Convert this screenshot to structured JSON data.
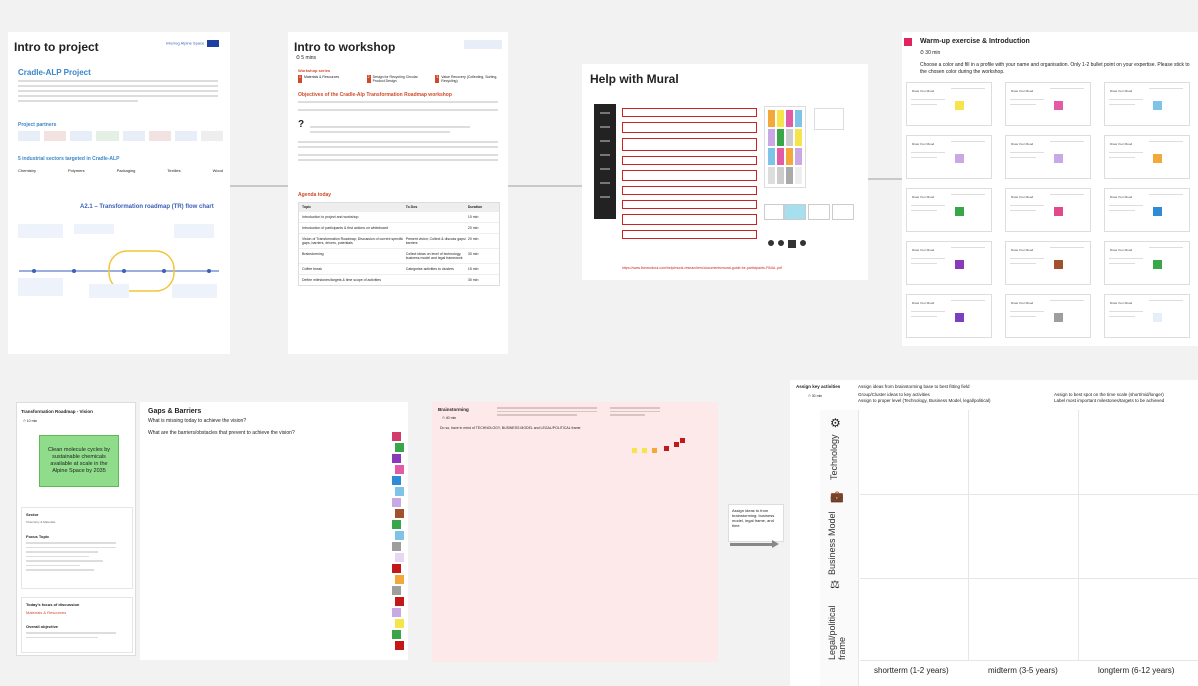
{
  "intro_project": {
    "title": "Intro to project",
    "brand": "Interreg Alpine Space",
    "project_title": "Cradle-ALP Project",
    "partners_label": "Project partners",
    "sectors_label": "5 industrial sectors targeted in Cradle-ALP",
    "sectors": [
      "Chemistry",
      "Polymers",
      "Packaging",
      "Textiles",
      "Wood"
    ],
    "flow_title": "A2.1 – Transformation roadmap (TR) flow chart",
    "colors": {
      "accent": "#3a5fb8",
      "project_title": "#3a86c8"
    }
  },
  "intro_workshop": {
    "title": "Intro to workshop",
    "duration": "5 mins",
    "series_label": "Workshop series",
    "series": [
      "Materials & Resources",
      "Design for Recycling Circular Product Design",
      "Value Recovery (Collecting, Sorting, Recycling)"
    ],
    "objectives_title": "Objectives of the Cradle-Alp Transformation Roadmap workshop",
    "agenda_title": "Agenda today",
    "agenda_headers": [
      "Topic",
      "To Dos",
      "Duration"
    ],
    "agenda_rows": [
      [
        "Introduction to project and workshop",
        "",
        "10 min"
      ],
      [
        "Introduction of participants & first actions on whiteboard",
        "",
        "20 min"
      ],
      [
        "Vision of Transformation Roadmap; Discussion of current specific gaps, barriers, drivers, potentials",
        "Present vision; Collect & discuss gaps/ barriers",
        "20 min"
      ],
      [
        "Brainstorming",
        "Collect ideas on level of technology, business model and legal framework",
        "30 min"
      ],
      [
        "Coffee break",
        "Categorise activities to clusters",
        "15 min"
      ],
      [
        "Define milestones/targets & time scope of activities",
        "",
        "30 min"
      ]
    ]
  },
  "help_mural": {
    "title": "Help with Mural",
    "url": "https://www.liveworkout.com/help/mural-researchers/documents/mural-guide-for-participants-FINAL.pdf"
  },
  "warmup": {
    "title": "Warm-up exercise & Introduction",
    "duration": "30 min",
    "instructions": "Choose a color and fill in a profile with your name and organisation. Only 1-2 bullet point on your expertise. Please stick to the chosen color during the workshop.",
    "card_label": "Draw Your Mood",
    "card_colors": [
      "#f5e44a",
      "#e35aa6",
      "#7ec3e8",
      "#c9a8e6",
      "#c9a8e6",
      "#f2a93a",
      "#3aa64a",
      "#e04a8a",
      "#2f8ad8",
      "#8a3ab8",
      "#a0522d",
      "#3aa64a",
      "#7a40c0",
      "#9e9e9e",
      "#e6eef8",
      "#c21818"
    ]
  },
  "vision": {
    "header": "Transformation Roadmap - Vision",
    "timer": "10 min",
    "vision_text": "Clean molecule cycles by sustainable chemicals available at scale in the Alpine Space by 2035",
    "sector_label": "Sector",
    "sector_value": "Chemistry & Materials",
    "focus_label": "Focus Topic",
    "today_label": "Today's focus of discussion",
    "today_value": "Materials & Resources",
    "objective_label": "Overall objective"
  },
  "gaps": {
    "title": "Gaps & Barriers",
    "subtitle": "What is missing today to achieve the vision?",
    "question": "What are the barriers/obstacles that prevent to achieve the vision?",
    "colors": [
      "#d13a6a",
      "#3aa64a",
      "#8a3ab8",
      "#e35aa6",
      "#2f8ad8",
      "#7ec3e8",
      "#c9a8e6",
      "#a0522d",
      "#3aa64a",
      "#7ec3e8",
      "#9e9e9e",
      "#e6d8f0",
      "#c21818",
      "#f2a93a",
      "#9e9e9e",
      "#c21818",
      "#c9a8e6",
      "#f5e44a",
      "#3aa64a",
      "#c21818"
    ]
  },
  "brainstorm": {
    "title": "Brainstorming",
    "duration": "40 min",
    "focus_line": "Do so, have in mind of TECHNOLOGY, BUSINESS MODEL and LEGAL/POLITICAL frame",
    "next_steps": "Assign ideas to from brainstorming: business model, legal frame, and time",
    "arrow_label": "Assign ideas to from brainstorming: business model, legal frame, and time",
    "sticky_colors": [
      "#c21818",
      "#f5e44a",
      "#f5e44a",
      "#f2a93a",
      "#c21818",
      "#c21818"
    ]
  },
  "roadmap": {
    "assign_title": "Assign key activities",
    "assign_note": "Assign ideas from brainstorming base to best fitting field",
    "bullets": [
      "Group/Cluster ideas to key activities",
      "Assign to proper level (Technology, Business Model, legal/political)"
    ],
    "bullets_right": [
      "Assign to best spot on the time scale (short/mid/longer)",
      "Label most important milestones/targets to be achieved"
    ],
    "rows": [
      "Technology",
      "Business Model",
      "Legal/political frame"
    ],
    "columns": [
      "shortterm (1-2 years)",
      "midterm (3-5 years)",
      "longterm (6-12 years)"
    ],
    "timer": "30 min"
  },
  "icons": [
    "timer-icon",
    "gear-icon",
    "briefcase-icon",
    "gavel-icon",
    "arrow-right-icon"
  ]
}
